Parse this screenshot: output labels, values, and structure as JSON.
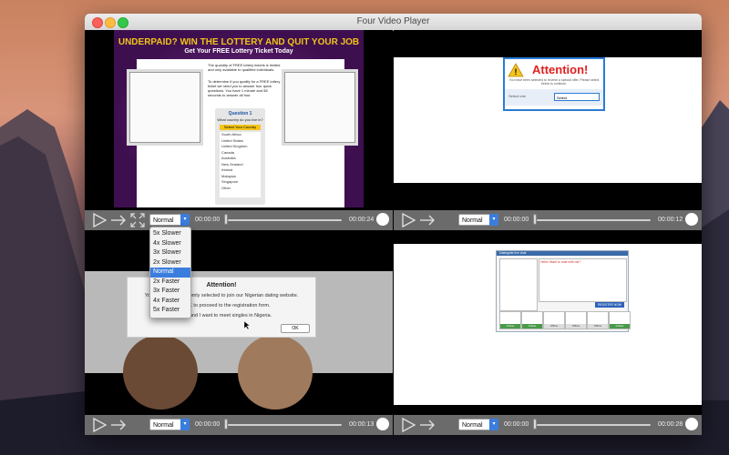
{
  "window": {
    "title": "Four Video Player"
  },
  "colors": {
    "accent": "#3b7ddd",
    "controlbar": "#6b6b6b",
    "close": "#fc605b",
    "minimize": "#fdbc40",
    "zoom": "#34c84a"
  },
  "icons": [
    "play-icon",
    "forward-arrow-icon",
    "fullscreen-icon",
    "volume-icon",
    "cursor-icon"
  ],
  "players": [
    {
      "speed": "Normal",
      "current_time": "00:00:00",
      "duration": "00:00:24",
      "progress": 0
    },
    {
      "speed": "Normal",
      "current_time": "00:00:00",
      "duration": "00:00:12",
      "progress": 0
    },
    {
      "speed": "Normal",
      "current_time": "00:00:00",
      "duration": "00:00:13",
      "progress": 0
    },
    {
      "speed": "Normal",
      "current_time": "00:00:00",
      "duration": "00:00:28",
      "progress": 0
    }
  ],
  "speed_menu": {
    "selected": "Normal",
    "options": [
      "5x Slower",
      "4x Slower",
      "3x Slower",
      "2x Slower",
      "Normal",
      "2x Faster",
      "3x Faster",
      "4x Faster",
      "5x Faster"
    ]
  },
  "video1": {
    "headline": "UNDERPAID? WIN THE LOTTERY AND QUIT YOUR JOB",
    "subhead": "Get Your FREE Lottery Ticket Today",
    "para1": "The quantity of FREE lottery tickets is limited and only available to qualified individuals.",
    "para2": "To determine if you qualify for a FREE lottery ticket we need you to answer four quick questions. You have 1 minute and 58 seconds to answer all four.",
    "question_title": "Question 1",
    "question": "What country do you live in?",
    "select_label": "Select Your Country",
    "countries": [
      "South Africa",
      "United States",
      "United Kingdom",
      "Canada",
      "Australia",
      "New Zealand",
      "Ireland",
      "Malaysia",
      "Singapore",
      "Other"
    ]
  },
  "video2": {
    "heading": "Attention!",
    "body": "You have been selected to receive a special offer. Please select below to continue.",
    "left_label": "Select one",
    "select_value": "Select"
  },
  "video3": {
    "heading": "Attention!",
    "line1": "You have been randomly selected to join our Nigerian dating website.",
    "line2": "Click OK to proceed to the registration form.",
    "line3": "I am 18 and I want to meet singles in Nigeria.",
    "ok_label": "OK"
  },
  "video4": {
    "header": "Datingsite live chat",
    "message": "Hello! Want to chat with me?",
    "register_label": "REGISTER NOW",
    "status_on": "Online",
    "status_off": "Offline"
  }
}
